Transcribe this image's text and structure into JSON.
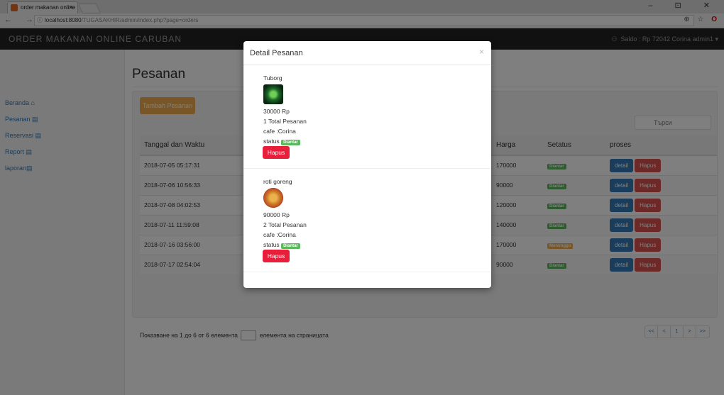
{
  "browser": {
    "tab_title": "order makanan online",
    "tab_close": "×",
    "url_host": "localhost:8080",
    "url_path": "/TUGASAKHIR/admin/index.php?page=orders",
    "info_icon": "ⓘ",
    "nav_glyphs": "← → C",
    "toolbar_glyphs": "⊕ ☆",
    "opera_glyph": "O",
    "window_controls": "– ⊡ ✕"
  },
  "navbar": {
    "brand": "ORDER MAKANAN ONLINE CARUBAN",
    "user_icon": "⚇",
    "user_text": "Saldo : Rp 72042 Corina admin1 ▾"
  },
  "sidebar": {
    "items": [
      {
        "label": "Beranda",
        "icon": "⌂"
      },
      {
        "label": "Pesanan",
        "icon": "▤"
      },
      {
        "label": "Reservasi",
        "icon": "▤"
      },
      {
        "label": "Report",
        "icon": "▤"
      },
      {
        "label": "laporan",
        "icon": "▤"
      }
    ]
  },
  "page": {
    "title": "Pesanan",
    "add_button": "Tambah Pesanan",
    "search_placeholder": "Търси",
    "columns": [
      "Tanggal dan Waktu",
      "",
      "",
      "",
      "Harga",
      "Setatus",
      "proses"
    ],
    "rows": [
      {
        "date": "2018-07-05 05:17:31",
        "harga": "170000",
        "status": "Diantar",
        "status_color": "#5cb85c"
      },
      {
        "date": "2018-07-06 10:56:33",
        "harga": "90000",
        "status": "Diantar",
        "status_color": "#5cb85c"
      },
      {
        "date": "2018-07-08 04:02:53",
        "harga": "120000",
        "status": "Diantar",
        "status_color": "#5cb85c"
      },
      {
        "date": "2018-07-11 11:59:08",
        "harga": "140000",
        "status": "Diantar",
        "status_color": "#5cb85c"
      },
      {
        "date": "2018-07-16 03:56:00",
        "harga": "170000",
        "status": "Menunggu",
        "status_color": "#f0ad4e"
      },
      {
        "date": "2018-07-17 02:54:04",
        "harga": "90000",
        "status": "Diantar",
        "status_color": "#5cb85c"
      }
    ],
    "detail_label": "detail",
    "hapus_label": "Hapus",
    "info_text": "Показване на 1 до 6 от 6 елемента",
    "length_suffix": "елемента на страницата",
    "pager": [
      "<<",
      "<",
      "1",
      ">",
      ">>"
    ]
  },
  "modal": {
    "title": "Detail Pesanan",
    "close": "×",
    "items": [
      {
        "name": "Tuborg",
        "price": "30000 Rp",
        "qty": "1 Total Pesanan",
        "cafe": "cafe :Corina",
        "status_label": "status",
        "status_badge": "Diantar",
        "delete_label": "Hapus",
        "image": "beer-icon"
      },
      {
        "name": "roti goreng",
        "price": "90000 Rp",
        "qty": "2 Total Pesanan",
        "cafe": "cafe :Corina",
        "status_label": "status",
        "status_badge": "Diantar",
        "delete_label": "Hapus",
        "image": "pizza-icon"
      }
    ]
  }
}
